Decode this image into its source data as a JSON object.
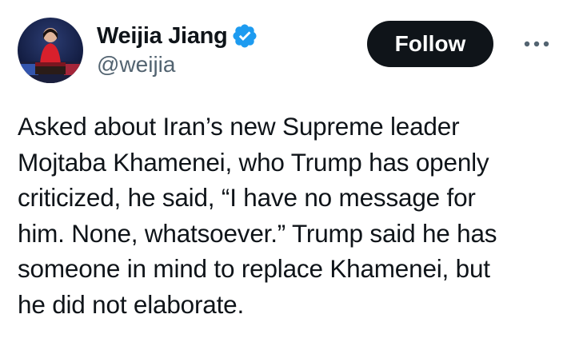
{
  "author": {
    "display_name": "Weijia Jiang",
    "handle": "@weijia",
    "verified": true
  },
  "actions": {
    "follow_label": "Follow",
    "more_icon": "more-horizontal-icon"
  },
  "tweet": {
    "lines": [
      "Asked about Iran’s new Supreme leader",
      "Mojtaba Khamenei, who Trump has openly",
      "criticized, he said, “I have no message for",
      "him. None, whatsoever.” Trump said he has",
      "someone in mind to replace Khamenei, but",
      "he did not elaborate."
    ]
  },
  "colors": {
    "text": "#0f1419",
    "secondary": "#536471",
    "verified_badge": "#1d9bf0",
    "follow_bg": "#0f1419"
  }
}
